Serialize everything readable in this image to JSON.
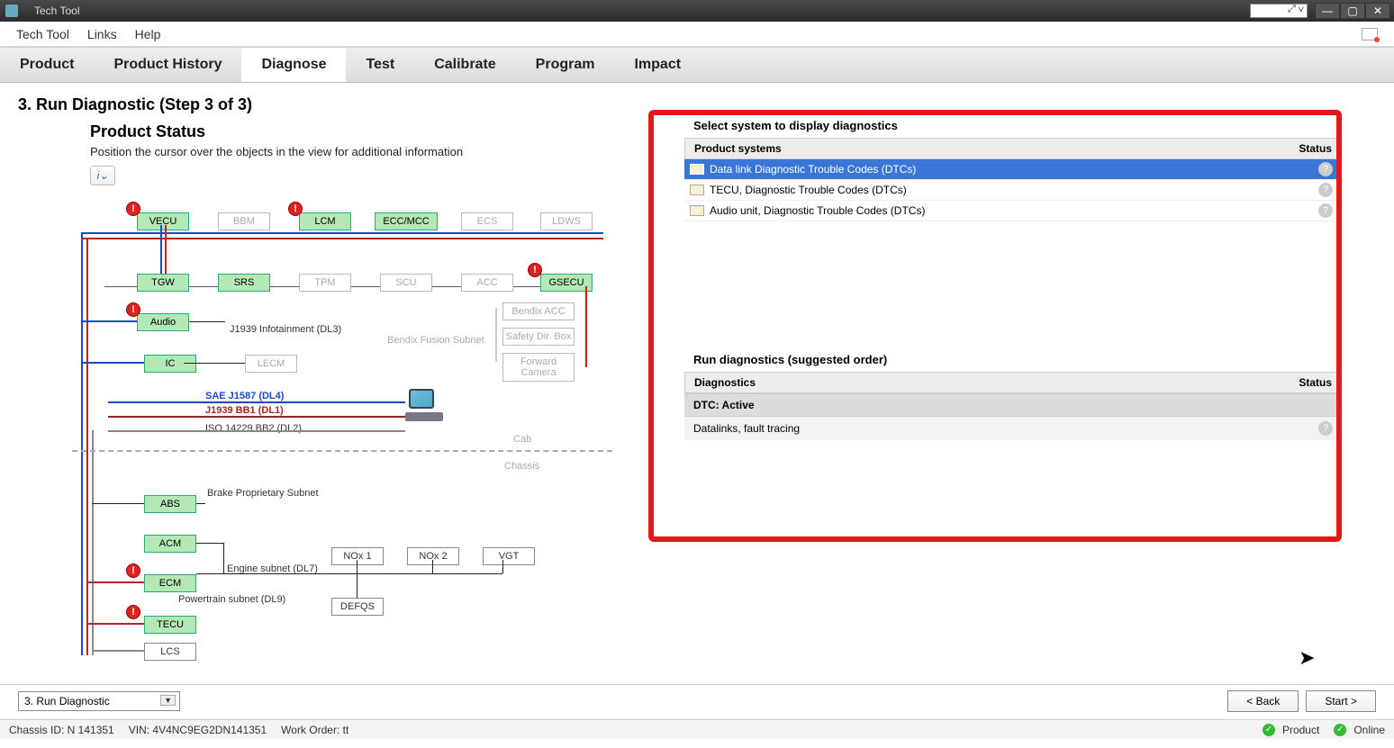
{
  "window": {
    "title": "Tech Tool"
  },
  "menubar": {
    "items": [
      "Tech Tool",
      "Links",
      "Help"
    ]
  },
  "tabs": {
    "items": [
      "Product",
      "Product History",
      "Diagnose",
      "Test",
      "Calibrate",
      "Program",
      "Impact"
    ],
    "active_index": 2
  },
  "page": {
    "heading": "3. Run Diagnostic (Step 3 of 3)",
    "status_title": "Product Status",
    "status_hint": "Position the cursor over the objects in the view for additional information"
  },
  "diagram": {
    "row1": [
      "VECU",
      "BBM",
      "LCM",
      "ECC/MCC",
      "ECS",
      "LDWS"
    ],
    "row2": [
      "TGW",
      "SRS",
      "TPM",
      "SCU",
      "ACC",
      "GSECU"
    ],
    "audio": "Audio",
    "ic": "IC",
    "lecm": "LECM",
    "bendix_group": [
      "Bendix ACC",
      "Safety Dir. Box",
      "Forward Camera"
    ],
    "infotainment_label": "J1939 Infotainment (DL3)",
    "bendix_subnet_label": "Bendix Fusion Subnet",
    "bus1": "SAE J1587 (DL4)",
    "bus2": "J1939 BB1 (DL1)",
    "bus3": "ISO 14229 BB2 (DL2)",
    "cab": "Cab",
    "chassis": "Chassis",
    "abs": "ABS",
    "abs_label": "Brake Proprietary Subnet",
    "acm": "ACM",
    "ecm": "ECM",
    "tecu": "TECU",
    "lcs": "LCS",
    "nox1": "NOx 1",
    "nox2": "NOx 2",
    "vgt": "VGT",
    "defqs": "DEFQS",
    "engine_label": "Engine subnet (DL7)",
    "powertrain_label": "Powertrain subnet (DL9)"
  },
  "right_panel": {
    "select_heading": "Select system to display diagnostics",
    "systems_header": {
      "col1": "Product systems",
      "col2": "Status"
    },
    "systems": [
      {
        "label": "Data link Diagnostic Trouble Codes (DTCs)",
        "selected": true
      },
      {
        "label": "TECU, Diagnostic Trouble Codes (DTCs)",
        "selected": false
      },
      {
        "label": "Audio unit, Diagnostic Trouble Codes (DTCs)",
        "selected": false
      }
    ],
    "run_heading": "Run diagnostics (suggested order)",
    "diag_header": {
      "col1": "Diagnostics",
      "col2": "Status"
    },
    "dtc_active": "DTC: Active",
    "diag_item": "Datalinks, fault tracing"
  },
  "bottom": {
    "combo": "3. Run Diagnostic",
    "back_btn": "< Back",
    "start_btn": "Start >"
  },
  "status": {
    "chassis": "Chassis ID: N 141351",
    "vin": "VIN: 4V4NC9EG2DN141351",
    "workorder": "Work Order: tt",
    "product": "Product",
    "online": "Online"
  }
}
